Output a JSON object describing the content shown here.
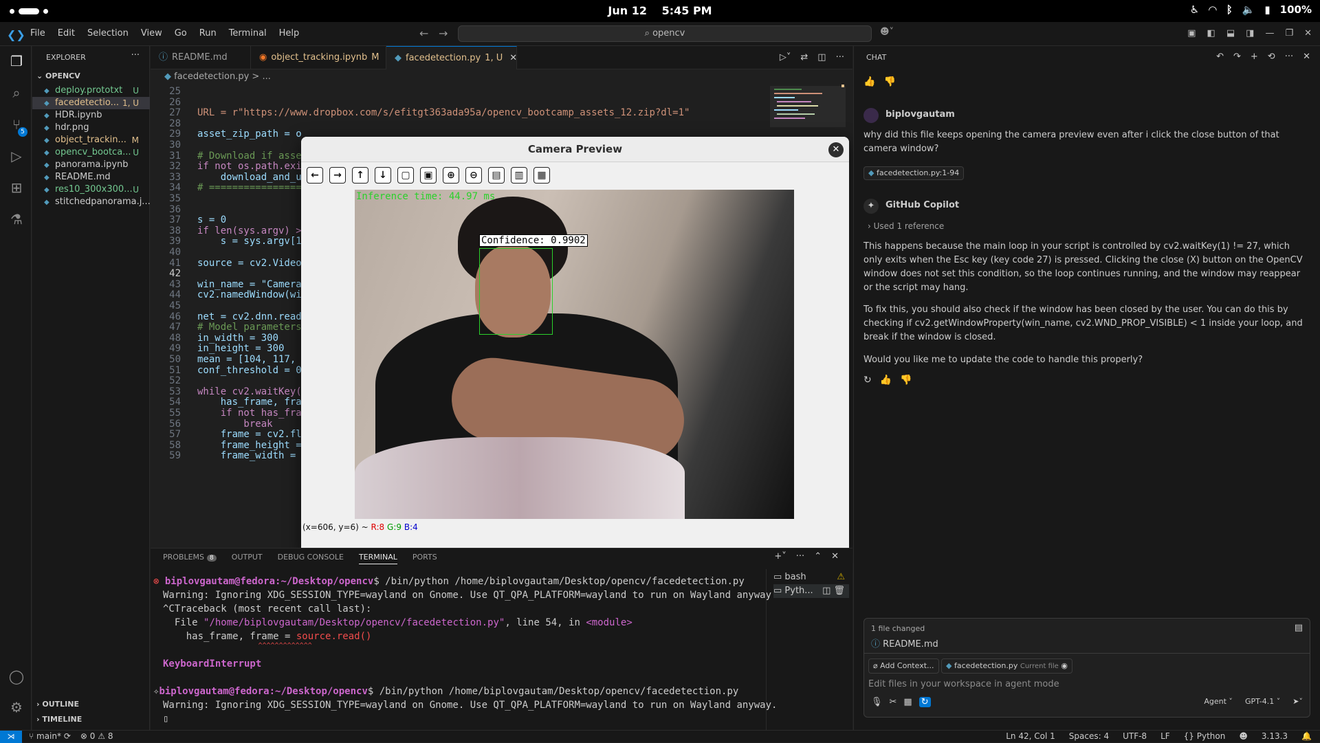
{
  "topbar": {
    "date": "Jun 12",
    "time": "5:45 PM",
    "battery": "100%"
  },
  "titlebar": {
    "menu": [
      "File",
      "Edit",
      "Selection",
      "View",
      "Go",
      "Run",
      "Terminal",
      "Help"
    ],
    "search": "opencv"
  },
  "activity": {
    "source_control_badge": "5"
  },
  "explorer": {
    "title": "EXPLORER",
    "folder": "OPENCV",
    "files": [
      {
        "name": "deploy.prototxt",
        "status": "U",
        "color": "#73c991"
      },
      {
        "name": "facedetectio...",
        "status": "1, U",
        "color": "#e2c08d"
      },
      {
        "name": "HDR.ipynb",
        "status": "",
        "color": "#cccccc"
      },
      {
        "name": "hdr.png",
        "status": "",
        "color": "#cccccc"
      },
      {
        "name": "object_trackin...",
        "status": "M",
        "color": "#e2c08d"
      },
      {
        "name": "opencv_bootca...",
        "status": "U",
        "color": "#73c991"
      },
      {
        "name": "panorama.ipynb",
        "status": "",
        "color": "#cccccc"
      },
      {
        "name": "README.md",
        "status": "",
        "color": "#cccccc"
      },
      {
        "name": "res10_300x300...",
        "status": "U",
        "color": "#73c991"
      },
      {
        "name": "stitchedpanorama.j...",
        "status": "",
        "color": "#cccccc"
      }
    ],
    "outline": "OUTLINE",
    "timeline": "TIMELINE"
  },
  "tabs": [
    {
      "label": "README.md",
      "mod": ""
    },
    {
      "label": "object_tracking.ipynb",
      "mod": "M"
    },
    {
      "label": "facedetection.py",
      "mod": "1, U"
    }
  ],
  "breadcrumb": "facedetection.py > ...",
  "code": {
    "lines": [
      {
        "n": "25",
        "t": ""
      },
      {
        "n": "26",
        "t": ""
      },
      {
        "n": "27",
        "t": "URL = r\"https://www.dropbox.com/s/efitgt363ada95a/opencv_bootcamp_assets_12.zip?dl=1\""
      },
      {
        "n": "28",
        "t": ""
      },
      {
        "n": "29",
        "t": "asset_zip_path = o"
      },
      {
        "n": "30",
        "t": ""
      },
      {
        "n": "31",
        "t": "# Download if asse"
      },
      {
        "n": "32",
        "t": "if not os.path.exi"
      },
      {
        "n": "33",
        "t": "    download_and_u"
      },
      {
        "n": "34",
        "t": "# ================"
      },
      {
        "n": "35",
        "t": ""
      },
      {
        "n": "36",
        "t": ""
      },
      {
        "n": "37",
        "t": "s = 0"
      },
      {
        "n": "38",
        "t": "if len(sys.argv) >"
      },
      {
        "n": "39",
        "t": "    s = sys.argv[1"
      },
      {
        "n": "40",
        "t": ""
      },
      {
        "n": "41",
        "t": "source = cv2.Video"
      },
      {
        "n": "42",
        "t": ""
      },
      {
        "n": "43",
        "t": "win_name = \"Camera"
      },
      {
        "n": "44",
        "t": "cv2.namedWindow(wi"
      },
      {
        "n": "45",
        "t": ""
      },
      {
        "n": "46",
        "t": "net = cv2.dnn.read"
      },
      {
        "n": "47",
        "t": "# Model parameters"
      },
      {
        "n": "48",
        "t": "in_width = 300"
      },
      {
        "n": "49",
        "t": "in_height = 300"
      },
      {
        "n": "50",
        "t": "mean = [104, 117,"
      },
      {
        "n": "51",
        "t": "conf_threshold = 0"
      },
      {
        "n": "52",
        "t": ""
      },
      {
        "n": "53",
        "t": "while cv2.waitKey("
      },
      {
        "n": "54",
        "t": "    has_frame, fra"
      },
      {
        "n": "55",
        "t": "    if not has_fra"
      },
      {
        "n": "56",
        "t": "        break"
      },
      {
        "n": "57",
        "t": "    frame = cv2.fl"
      },
      {
        "n": "58",
        "t": "    frame_height ="
      },
      {
        "n": "59",
        "t": "    frame_width ="
      }
    ]
  },
  "camera": {
    "title": "Camera Preview",
    "inference": "Inference time: 44.97 ms",
    "confidence": "Confidence: 0.9902",
    "coords": "(x=606, y=6) ~",
    "r": "R:8",
    "g": "G:9",
    "b": "B:4"
  },
  "panel": {
    "tabs": [
      "PROBLEMS",
      "OUTPUT",
      "DEBUG CONSOLE",
      "TERMINAL",
      "PORTS"
    ],
    "problems_count": "8",
    "terminal": {
      "prompt1_user": "biplovgautam@fedora",
      "prompt1_path": ":~/Desktop/opencv",
      "cmd1": "$ /bin/python /home/biplovgautam/Desktop/opencv/facedetection.py",
      "warn1": "Warning: Ignoring XDG_SESSION_TYPE=wayland on Gnome. Use QT_QPA_PLATFORM=wayland to run on Wayland anyway.",
      "tb": "^CTraceback (most recent call last):",
      "file_line_pre": "  File ",
      "file_line_path": "\"/home/biplovgautam/Desktop/opencv/facedetection.py\"",
      "file_line_mid": ", line 54, in ",
      "file_line_mod": "<module>",
      "src_pre": "    has_frame, frame = ",
      "src_call": "source.read()",
      "carets": "                       ^^^^^^^^^^^^^",
      "kbi": "KeyboardInterrupt",
      "prompt2_user": "biplovgautam@fedora",
      "prompt2_path": ":~/Desktop/opencv",
      "cmd2": "$ /bin/python /home/biplovgautam/Desktop/opencv/facedetection.py",
      "warn2": "Warning: Ignoring XDG_SESSION_TYPE=wayland on Gnome. Use QT_QPA_PLATFORM=wayland to run on Wayland anyway."
    },
    "term_list": [
      "bash",
      "Pyth..."
    ]
  },
  "chat": {
    "title": "CHAT",
    "user": "biplovgautam",
    "question": "why did this file keeps opening the camera preview even after i click the close button of that camera window?",
    "ref_chip": "facedetection.py:1-94",
    "assistant": "GitHub Copilot",
    "used_ref": "Used 1 reference",
    "p1": "This happens because the main loop in your script is controlled by cv2.waitKey(1) != 27, which only exits when the Esc key (key code 27) is pressed. Clicking the close (X) button on the OpenCV window does not set this condition, so the loop continues running, and the window may reappear or the script may hang.",
    "p2": "To fix this, you should also check if the window has been closed by the user. You can do this by checking if cv2.getWindowProperty(win_name, cv2.WND_PROP_VISIBLE) < 1 inside your loop, and break if the window is closed.",
    "p3": "Would you like me to update the code to handle this properly?",
    "files_changed": "1 file changed",
    "changed_file": "README.md",
    "add_context": "Add Context...",
    "current_file": "facedetection.py",
    "current_file_tag": "Current file",
    "placeholder": "Edit files in your workspace in agent mode",
    "mode": "Agent",
    "model": "GPT-4.1"
  },
  "statusbar": {
    "branch": "main*",
    "errors": "0",
    "warnings": "8",
    "position": "Ln 42, Col 1",
    "spaces": "Spaces: 4",
    "encoding": "UTF-8",
    "eol": "LF",
    "language": "Python",
    "version": "3.13.3"
  }
}
